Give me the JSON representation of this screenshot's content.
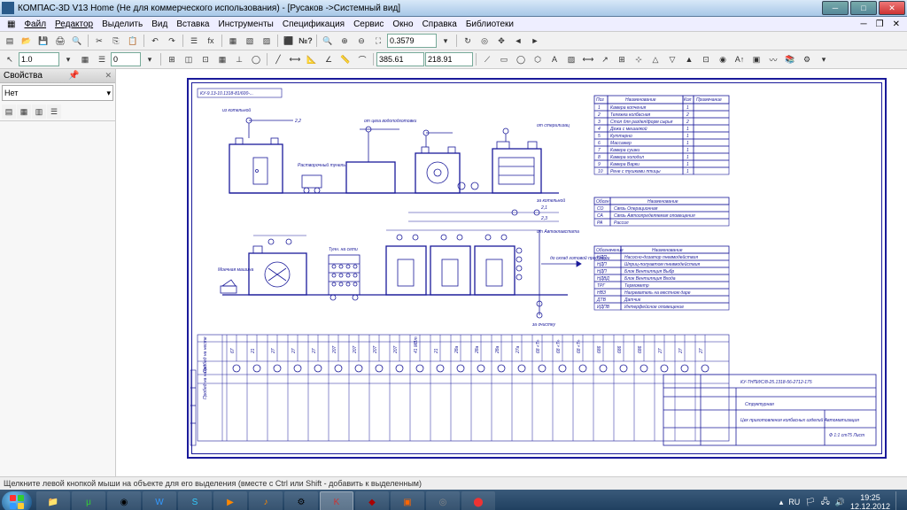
{
  "window": {
    "title": "КОМПАС-3D V13 Home (Не для коммерческого использования) - [Русаков ->Системный вид]"
  },
  "menu": {
    "file": "Файл",
    "editor": "Редактор",
    "select": "Выделить",
    "view": "Вид",
    "insert": "Вставка",
    "tools": "Инструменты",
    "spec": "Спецификация",
    "service": "Сервис",
    "window": "Окно",
    "help": "Справка",
    "lib": "Библиотеки"
  },
  "toolbar2": {
    "scale": "1.0",
    "step": "0",
    "zoom": "0.3579",
    "x": "385.61",
    "y": "218.91"
  },
  "sidebar": {
    "title": "Свойства",
    "combo": "Нет"
  },
  "statusbar": {
    "hint": "Щелкните левой кнопкой мыши на объекте для его выделения (вместе с Ctrl или Shift - добавить к выделенным)"
  },
  "taskbar": {
    "lang": "RU",
    "time": "19:25",
    "date": "12.12.2012"
  },
  "drawing": {
    "stamp_code": "КУ-9.13-10.1318-81/600-...",
    "labels": {
      "from_boiler": "из котельной",
      "to_boiler": "за котельной",
      "to_water": "от цеха водоподготовки",
      "rast_tunnel": "Растворочный тунель",
      "washing": "Моечная машина",
      "to_cleaning": "за очистку",
      "to_sterile": "от стерилизац",
      "from_autoclave": "от Автоклавстата",
      "to_warehouse": "до склад готовой продукции",
      "probed_neste": "Пробед на несте",
      "probed_nz": "Пробед на назад",
      "t21": "2,1",
      "t22": "2,2",
      "t23": "2,3"
    },
    "table1": {
      "h_pos": "Поз",
      "h_name": "Наименование",
      "h_qty": "Кол",
      "h_note": "Примечание",
      "rows": [
        {
          "n": "1",
          "name": "Камера копчения",
          "q": "1"
        },
        {
          "n": "2",
          "name": "Тележка колбасная",
          "q": "2"
        },
        {
          "n": "3",
          "name": "Стол для раздел/форм сырья",
          "q": "2"
        },
        {
          "n": "4",
          "name": "Дежа с мешалкой",
          "q": "1"
        },
        {
          "n": "5",
          "name": "Куттерно",
          "q": "1"
        },
        {
          "n": "6",
          "name": "Массажер",
          "q": "1"
        },
        {
          "n": "7",
          "name": "Камера сушки",
          "q": "1"
        },
        {
          "n": "8",
          "name": "Камера холодил",
          "q": "1"
        },
        {
          "n": "9",
          "name": "Камера Варки",
          "q": "1"
        },
        {
          "n": "10",
          "name": "Рене с тушками птицы",
          "q": "1"
        }
      ]
    },
    "table2": {
      "h1": "Обозн",
      "h2": "Наименование",
      "rows": [
        {
          "a": "СО",
          "b": "Связь Операционная"
        },
        {
          "a": "СА",
          "b": "Связь Автоопределяемая оповещения"
        },
        {
          "a": "РА",
          "b": "Рассол"
        }
      ]
    },
    "table3": {
      "h1": "Обозначение",
      "h2": "Наименование",
      "rows": [
        {
          "a": "НДП",
          "b": "Насосно-дозатор пневмодействия"
        },
        {
          "a": "НДП",
          "b": "Шприц-полуавтом пневмодействия"
        },
        {
          "a": "НДП",
          "b": "Блок Вентиляция Выбр"
        },
        {
          "a": "НДВД",
          "b": "Блок Вентиляция Входа"
        },
        {
          "a": "ТРГ",
          "b": "Термометр"
        },
        {
          "a": "НВЗ",
          "b": "Нагреватель на местном даре"
        },
        {
          "a": "ДТВ",
          "b": "Датчик"
        },
        {
          "a": "ИДПВ",
          "b": "Интерфейсное оповещение"
        }
      ]
    },
    "title_block": {
      "doc": "КУ-ТНПИ/С/8-25.1318-56-2712-175",
      "l1": "Структурная",
      "l2": "Цех приготовления колбасных изделий Автоматизация",
      "l3": "Ф 1:1 ст75 Лист"
    },
    "bottom_cols": [
      "67",
      "21",
      "27",
      "27",
      "27",
      "207",
      "207",
      "207",
      "207",
      "41 МВт",
      "21",
      "28а",
      "28а",
      "28а",
      "27а",
      "68 «Т»",
      "68 «Т»",
      "68 «Т»",
      "686",
      "686",
      "686",
      "27",
      "27",
      "27"
    ]
  }
}
